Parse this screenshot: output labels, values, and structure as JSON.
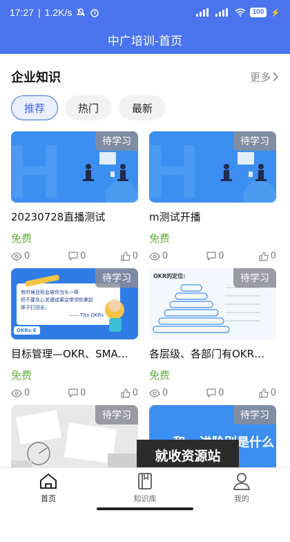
{
  "status": {
    "time": "17:27",
    "speed": "1.2K/s",
    "battery": "100"
  },
  "app": {
    "title": "中广培训-首页"
  },
  "section": {
    "title": "企业知识",
    "more": "更多"
  },
  "tabs": [
    {
      "label": "推荐",
      "active": true
    },
    {
      "label": "热门",
      "active": false
    },
    {
      "label": "最新",
      "active": false
    }
  ],
  "cards": [
    {
      "badge": "待学习",
      "title": "20230728直播测试",
      "price": "免费",
      "views": "0",
      "comments": "0",
      "likes": "0",
      "thumb": "h-blue"
    },
    {
      "badge": "待学习",
      "title": "m测试开播",
      "price": "免费",
      "views": "0",
      "comments": "0",
      "likes": "0",
      "thumb": "h-blue"
    },
    {
      "badge": "待学习",
      "title": "目标管理—OKR、SMA…",
      "price": "免费",
      "views": "0",
      "comments": "0",
      "likes": "0",
      "thumb": "okr-banner",
      "thumb_text": {
        "line1": "有时候目标会被你当头一棒",
        "line2": "但不要灰心关键成果会带领你拿起",
        "line3": "棒子打回去。",
        "author": "—— Tita OKRs",
        "tag": "OKRs-E"
      }
    },
    {
      "badge": "待学习",
      "title": "各层级、各部门有OKR…",
      "price": "免费",
      "views": "0",
      "comments": "0",
      "likes": "0",
      "thumb": "okr-pyramid",
      "thumb_text": {
        "heading": "OKR的定位:"
      }
    },
    {
      "badge": "待学习",
      "title": "",
      "price": "",
      "views": "",
      "comments": "",
      "likes": "",
      "thumb": "paper"
    },
    {
      "badge": "待学习",
      "title": "",
      "price": "",
      "views": "",
      "comments": "",
      "likes": "",
      "thumb": "blue-text",
      "thumb_text": {
        "line1": "...和...进阶别是什么"
      }
    }
  ],
  "watermark": "就收资源站",
  "nav": [
    {
      "label": "首页",
      "icon": "home-icon",
      "active": true
    },
    {
      "label": "知识库",
      "icon": "book-icon",
      "active": false
    },
    {
      "label": "我的",
      "icon": "user-icon",
      "active": false
    }
  ],
  "colors": {
    "primary": "#4a74ee",
    "free": "#62b13d",
    "badge": "#8c8c96"
  }
}
